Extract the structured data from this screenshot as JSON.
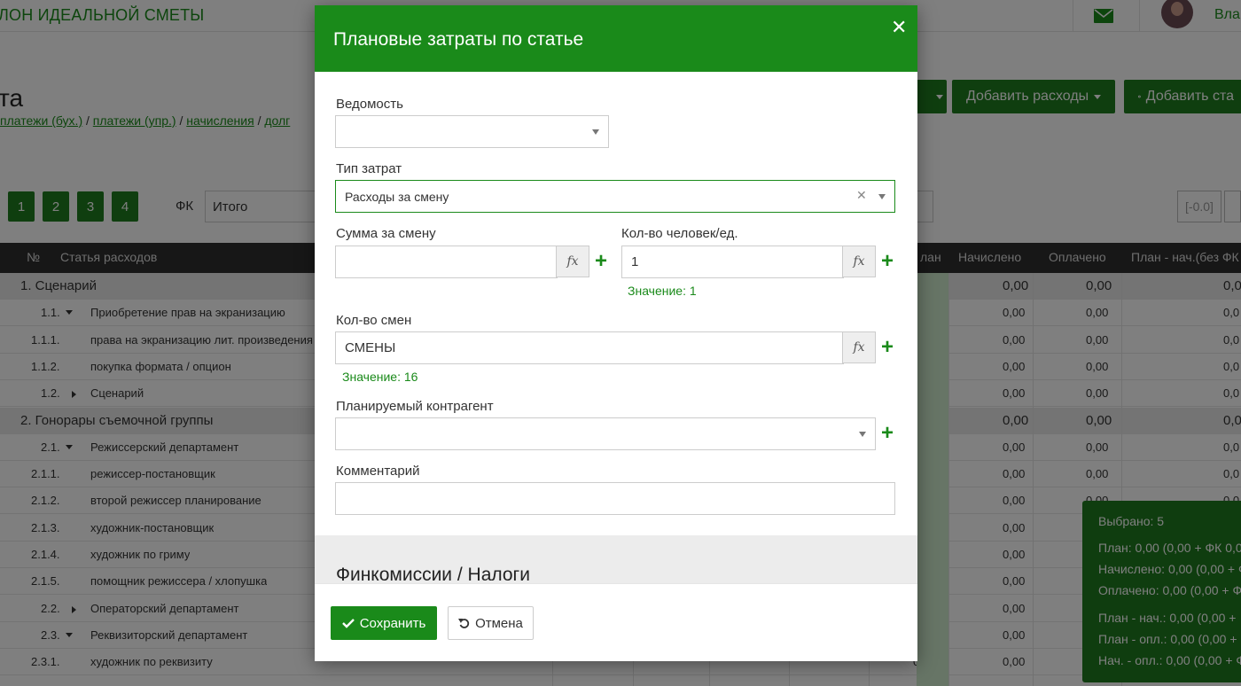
{
  "header": {
    "brand": "ЛОН ИДЕАЛЬНОЙ СМЕТЫ",
    "user_name": "Вла"
  },
  "page": {
    "title": "та",
    "links": [
      "платежи (бух.)",
      "платежи (упр.)",
      "начисления",
      "долг"
    ],
    "add_expenses_label": "Добавить расходы",
    "add_article_label": "Добавить ста",
    "page_buttons": [
      "1",
      "2",
      "3",
      "4"
    ],
    "fk_label": "ФК",
    "fk_value": "Итого",
    "neg_value": "[-0.0]"
  },
  "table": {
    "headers": {
      "num": "№",
      "name": "Статья расходов",
      "plan": "лан",
      "accrued": "Начислено",
      "paid": "Оплачено",
      "plan_minus": "План - нач.(без ФК"
    },
    "rows": [
      {
        "num": "1. Сценарий",
        "name": "",
        "group": true,
        "v1": "0,00",
        "v2": "0,00",
        "v3": "0,00",
        "v4": "0,0"
      },
      {
        "num": "1.1.",
        "name": "Приобретение прав на экранизацию",
        "caret": "down",
        "v1": "0,00",
        "v2": "0,00",
        "v3": "0,00",
        "v4": "0,0"
      },
      {
        "num": "1.1.1.",
        "name": "права на экранизацию лит. произведения",
        "v1": "0,00",
        "v2": "0,00",
        "v3": "0,00",
        "v4": "0,0"
      },
      {
        "num": "1.1.2.",
        "name": "покупка формата / опцион",
        "v1": "0,00",
        "v2": "0,00",
        "v3": "0,00",
        "v4": "0,0"
      },
      {
        "num": "1.2.",
        "name": "Сценарий",
        "caret": "right",
        "v1": "0,00",
        "v2": "0,00",
        "v3": "0,00",
        "v4": "0,0"
      },
      {
        "num": "2. Гонорары съемочной группы",
        "name": "",
        "group": true,
        "v1": "0,00",
        "v2": "0,00",
        "v3": "0,00",
        "v4": "0,0"
      },
      {
        "num": "2.1.",
        "name": "Режиссерский департамент",
        "caret": "down",
        "v1": "0,00",
        "v2": "0,00",
        "v3": "0,00",
        "v4": "0,0"
      },
      {
        "num": "2.1.1.",
        "name": "режиссер-постановщик",
        "v1": "0,00",
        "v2": "0,00",
        "v3": "0,00",
        "v4": "0,0"
      },
      {
        "num": "2.1.2.",
        "name": "второй режиссер планирование",
        "v1": "0,00",
        "v2": "0,00",
        "v3": "0,00",
        "v4": "0,0"
      },
      {
        "num": "2.1.3.",
        "name": "художник-постановщик",
        "v1": "0,00",
        "v2": "0,00",
        "v3": "0,00",
        "v4": "0,0"
      },
      {
        "num": "2.1.4.",
        "name": "художник по гриму",
        "v1": "0,00",
        "v2": "0,00",
        "v3": "0,00",
        "v4": "0,0"
      },
      {
        "num": "2.1.5.",
        "name": "помощник режиссера / хлопушка",
        "v1": "0,00",
        "v2": "0,00",
        "v3": "0,00",
        "v4": "0,0"
      },
      {
        "num": "2.2.",
        "name": "Операторский департамент",
        "caret": "right",
        "v1": "0,00",
        "v2": "0,00",
        "v3": "0,00",
        "v4": "0,0"
      },
      {
        "num": "2.3.",
        "name": "Реквизиторский департамент",
        "caret": "down",
        "v1": "0,00",
        "v2": "0,00",
        "v3": "0,00",
        "v4": "0,0"
      },
      {
        "num": "2.3.1.",
        "name": "художник по реквизиту",
        "v1": "0,00",
        "v2": "0,00",
        "v3": "0,00",
        "v4": "0,0"
      }
    ]
  },
  "summary": {
    "selected": "Выбрано: 5",
    "plan": "План: 0,00 (0,00 + ФК 0,0",
    "accrued": "Начислено: 0,00 (0,00 + Ф",
    "paid": "Оплачено: 0,00 (0,00 + Ф",
    "plan_acc": "План - нач.: 0,00 (0,00 +",
    "plan_paid": "План - опл.: 0,00 (0,00 +",
    "acc_paid": "Нач. - опл.: 0,00 (0,00 + Ф"
  },
  "modal": {
    "title": "Плановые затраты по статье",
    "vedomost_label": "Ведомость",
    "vedomost_value": "",
    "cost_type_label": "Тип затрат",
    "cost_type_value": "Расходы за смену",
    "sum_label": "Сумма за смену",
    "sum_value": "",
    "people_label": "Кол-во человек/ед.",
    "people_value": "1",
    "people_hint": "Значение: 1",
    "shifts_label": "Кол-во смен",
    "shifts_value": "СМЕНЫ",
    "shifts_hint": "Значение: 16",
    "counterparty_label": "Планируемый контрагент",
    "counterparty_value": "",
    "comment_label": "Комментарий",
    "comment_value": "",
    "section_title": "Финкомиссии / Налоги",
    "fx": "fx",
    "save_label": "Сохранить",
    "cancel_label": "Отмена"
  }
}
